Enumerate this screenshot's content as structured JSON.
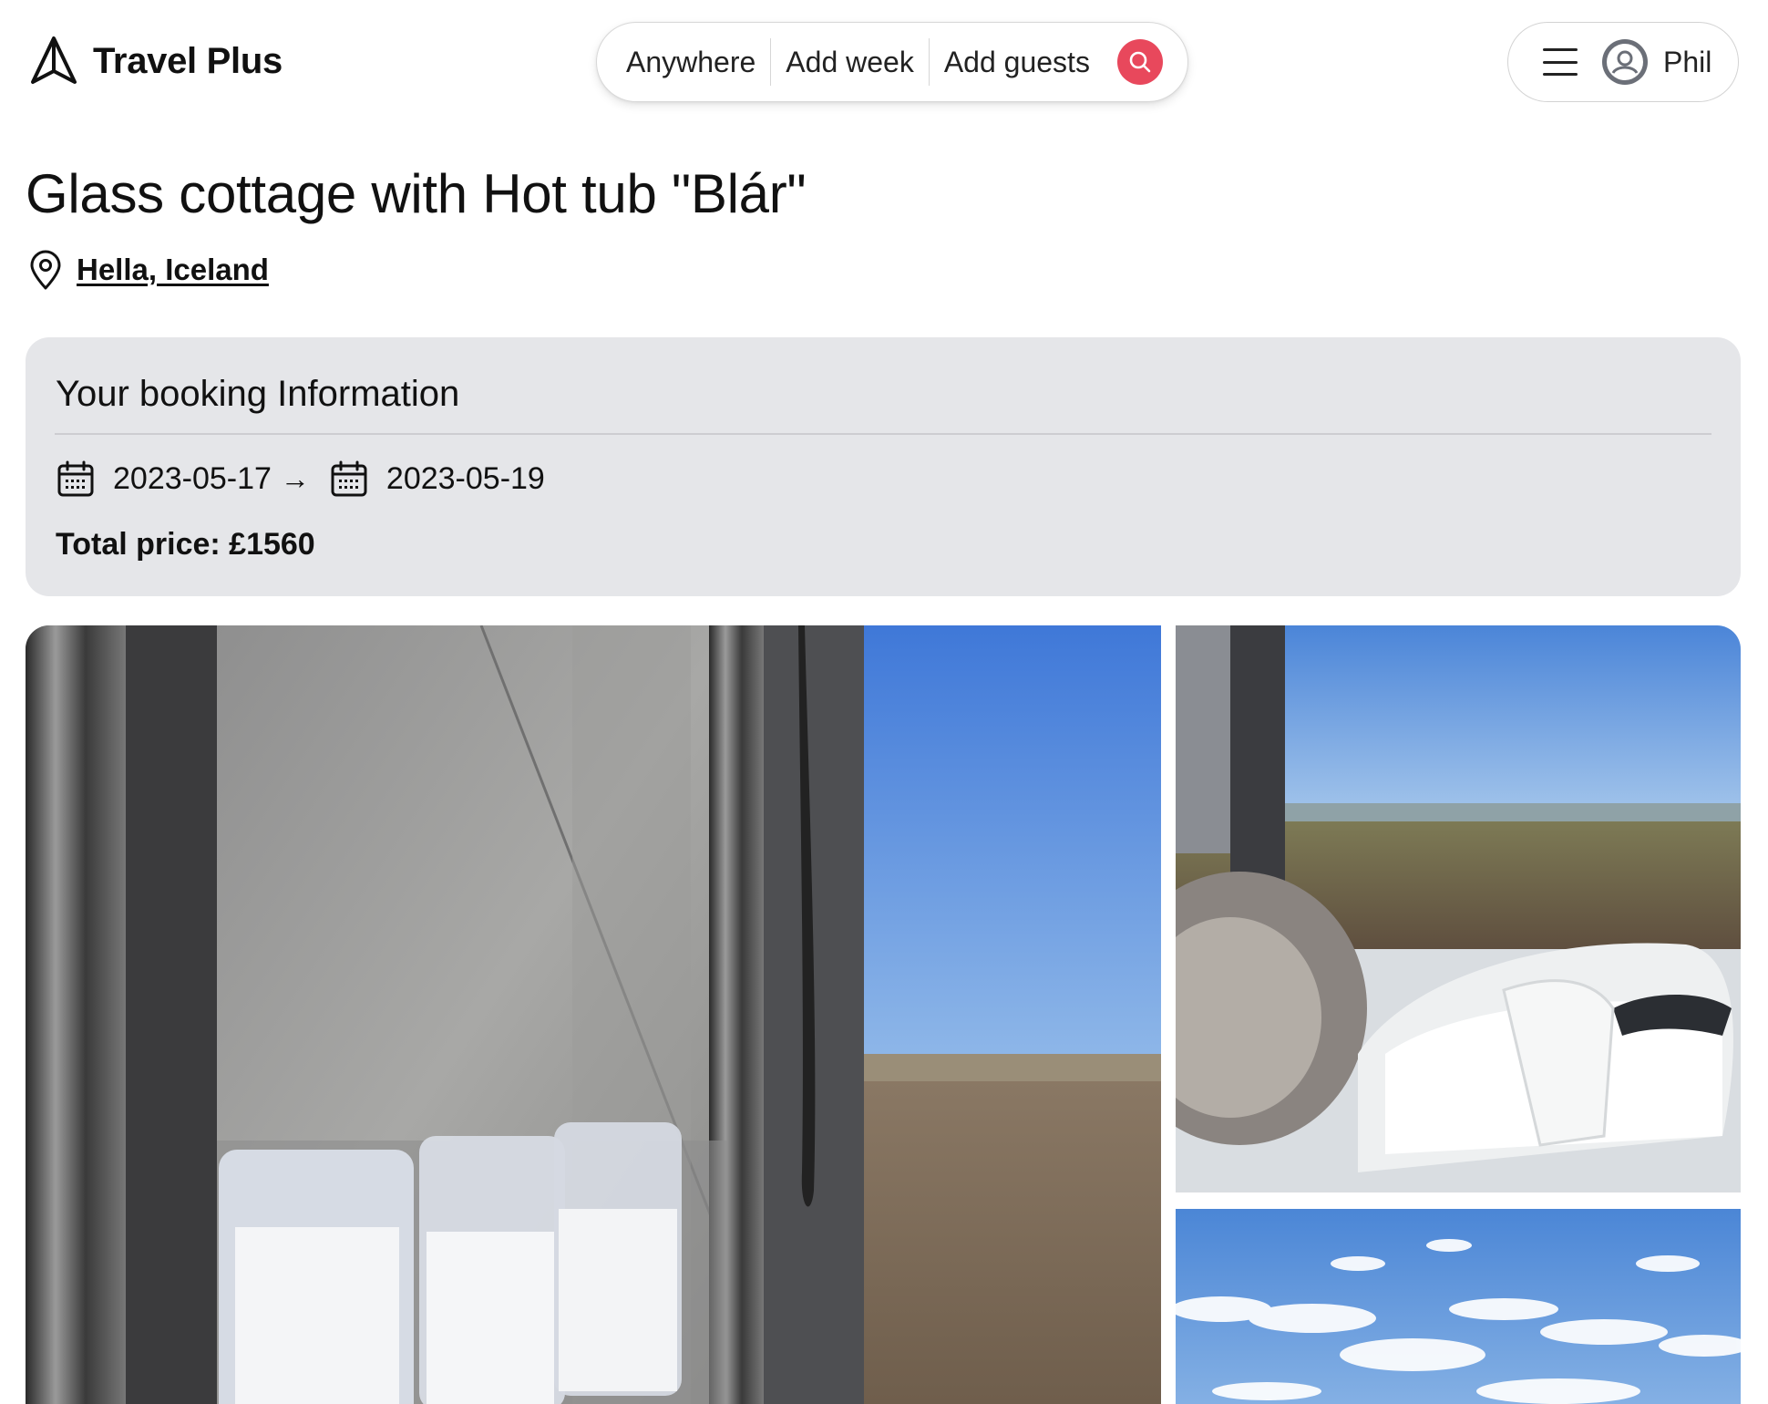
{
  "brand": {
    "name": "Travel Plus",
    "logo_icon": "navigation-arrow-icon"
  },
  "search": {
    "location": "Anywhere",
    "dates": "Add week",
    "guests": "Add guests",
    "button_icon": "search-icon",
    "accent_color": "#e8485c"
  },
  "user": {
    "menu_icon": "hamburger-icon",
    "avatar_icon": "user-circle-icon",
    "name": "Phil"
  },
  "listing": {
    "title": "Glass cottage with Hot tub \"Blár\"",
    "location_icon": "map-pin-icon",
    "location": "Hella, Iceland"
  },
  "booking": {
    "heading": "Your booking Information",
    "check_in": "2023-05-17",
    "arrow": "→",
    "check_out": "2023-05-19",
    "total_price": "Total price: £1560",
    "card_color": "#e5e6e9"
  },
  "gallery": {
    "photos": [
      {
        "subject": "bathroom shelf with jars beside window"
      },
      {
        "subject": "folded bathrobes on bed by window"
      },
      {
        "subject": "blue sky with clouds"
      }
    ]
  }
}
